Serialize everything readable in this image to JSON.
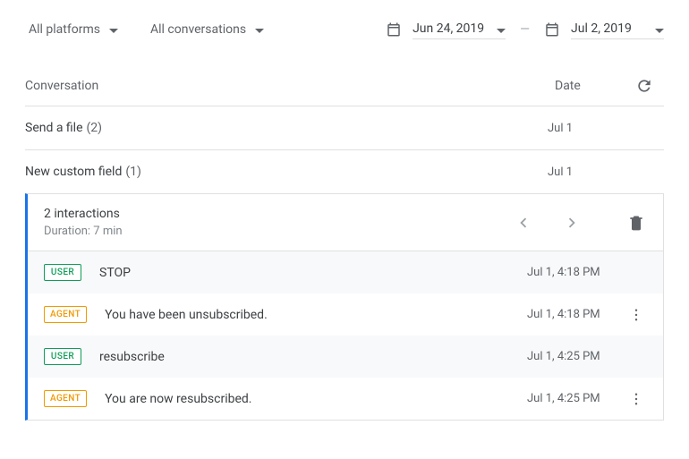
{
  "filters": {
    "platform": "All platforms",
    "conversations": "All conversations",
    "startDate": "Jun 24, 2019",
    "endDate": "Jul 2, 2019"
  },
  "headers": {
    "conversation": "Conversation",
    "date": "Date"
  },
  "rows": [
    {
      "title": "Send a file",
      "count": "(2)",
      "date": "Jul 1"
    },
    {
      "title": "New custom field",
      "count": "(1)",
      "date": "Jul 1"
    }
  ],
  "panel": {
    "interactions": "2 interactions",
    "duration": "Duration: 7 min",
    "messages": [
      {
        "type": "USER",
        "text": "STOP",
        "time": "Jul 1, 4:18 PM",
        "more": false
      },
      {
        "type": "AGENT",
        "text": "You have been unsubscribed.",
        "time": "Jul 1, 4:18 PM",
        "more": true
      },
      {
        "type": "USER",
        "text": "resubscribe",
        "time": "Jul 1, 4:25 PM",
        "more": false
      },
      {
        "type": "AGENT",
        "text": "You are now resubscribed.",
        "time": "Jul 1, 4:25 PM",
        "more": true
      }
    ]
  }
}
